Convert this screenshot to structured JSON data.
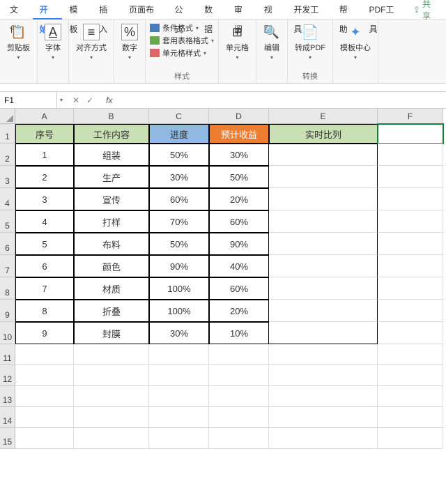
{
  "menu": {
    "tabs": [
      "文件",
      "开始",
      "模板",
      "插入",
      "页面布局",
      "公式",
      "数据",
      "审阅",
      "视图",
      "开发工具",
      "帮助",
      "PDF工具"
    ],
    "active_index": 1,
    "share": "共享"
  },
  "ribbon": {
    "clipboard": {
      "label": "剪贴板",
      "icon": "📋"
    },
    "font": {
      "label": "字体",
      "icon": "A"
    },
    "align": {
      "label": "对齐方式",
      "icon": "≡"
    },
    "number": {
      "label": "数字",
      "icon": "%"
    },
    "styles": {
      "label": "样式",
      "cond": "条件格式",
      "table": "套用表格格式",
      "cell": "单元格样式"
    },
    "cells": {
      "label": "单元格",
      "icon": "⊞"
    },
    "edit": {
      "label": "编辑",
      "icon": "🔍"
    },
    "convert": {
      "label": "转换",
      "pdf": "转成PDF"
    },
    "tmpl": {
      "label": "模板中心",
      "icon": "✦"
    }
  },
  "formula_bar": {
    "name": "F1",
    "fx": "fx"
  },
  "columns": [
    "A",
    "B",
    "C",
    "D",
    "E",
    "F"
  ],
  "headers": {
    "a": "序号",
    "b": "工作内容",
    "c": "进度",
    "d": "预计收益",
    "e": "实时比列"
  },
  "rows": [
    {
      "n": "1",
      "work": "组装",
      "prog": "50%",
      "rev": "30%"
    },
    {
      "n": "2",
      "work": "生产",
      "prog": "30%",
      "rev": "50%"
    },
    {
      "n": "3",
      "work": "宣传",
      "prog": "60%",
      "rev": "20%"
    },
    {
      "n": "4",
      "work": "打样",
      "prog": "70%",
      "rev": "60%"
    },
    {
      "n": "5",
      "work": "布料",
      "prog": "50%",
      "rev": "90%"
    },
    {
      "n": "6",
      "work": "颜色",
      "prog": "90%",
      "rev": "40%"
    },
    {
      "n": "7",
      "work": "材质",
      "prog": "100%",
      "rev": "60%"
    },
    {
      "n": "8",
      "work": "折叠",
      "prog": "100%",
      "rev": "20%"
    },
    {
      "n": "9",
      "work": "封膜",
      "prog": "30%",
      "rev": "10%"
    }
  ]
}
